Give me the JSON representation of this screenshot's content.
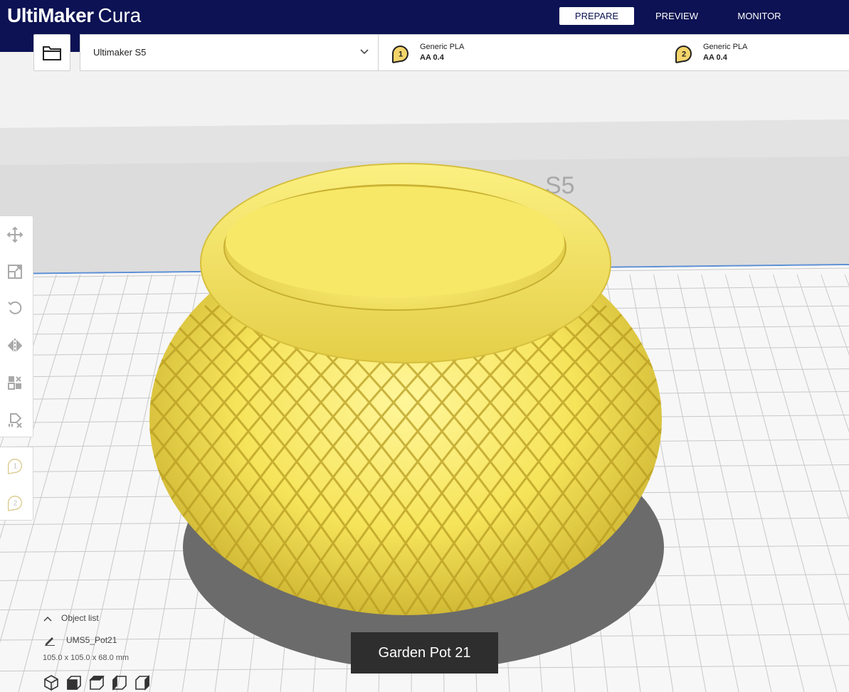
{
  "app": {
    "logo_bold": "UltiMaker",
    "logo_light": "Cura"
  },
  "stages": {
    "prepare": "PREPARE",
    "preview": "PREVIEW",
    "monitor": "MONITOR",
    "active": "PREPARE"
  },
  "printer": {
    "name": "Ultimaker S5"
  },
  "extruders": [
    {
      "number": "1",
      "material": "Generic PLA",
      "core": "AA 0.4"
    },
    {
      "number": "2",
      "material": "Generic PLA",
      "core": "AA 0.4"
    }
  ],
  "build_plate": {
    "label": "S5"
  },
  "tools": [
    {
      "icon": "move-icon"
    },
    {
      "icon": "scale-icon"
    },
    {
      "icon": "rotate-icon"
    },
    {
      "icon": "mirror-icon"
    },
    {
      "icon": "per-model-settings-icon"
    },
    {
      "icon": "support-blocker-icon"
    }
  ],
  "object_list": {
    "toggle_label": "Object list",
    "item_name": "UMS5_Pot21",
    "dimensions": "105.0 x 105.0 x 68.0 mm"
  },
  "view_buttons": [
    {
      "icon": "3d-view-icon"
    },
    {
      "icon": "front-view-icon"
    },
    {
      "icon": "top-view-icon"
    },
    {
      "icon": "left-view-icon"
    },
    {
      "icon": "right-view-icon"
    }
  ],
  "caption": "Garden Pot 21",
  "colors": {
    "header": "#0c1253",
    "model": "#f4e35a",
    "shadow": "#6b6b6b",
    "extruder_badge": "#f3d46a"
  }
}
